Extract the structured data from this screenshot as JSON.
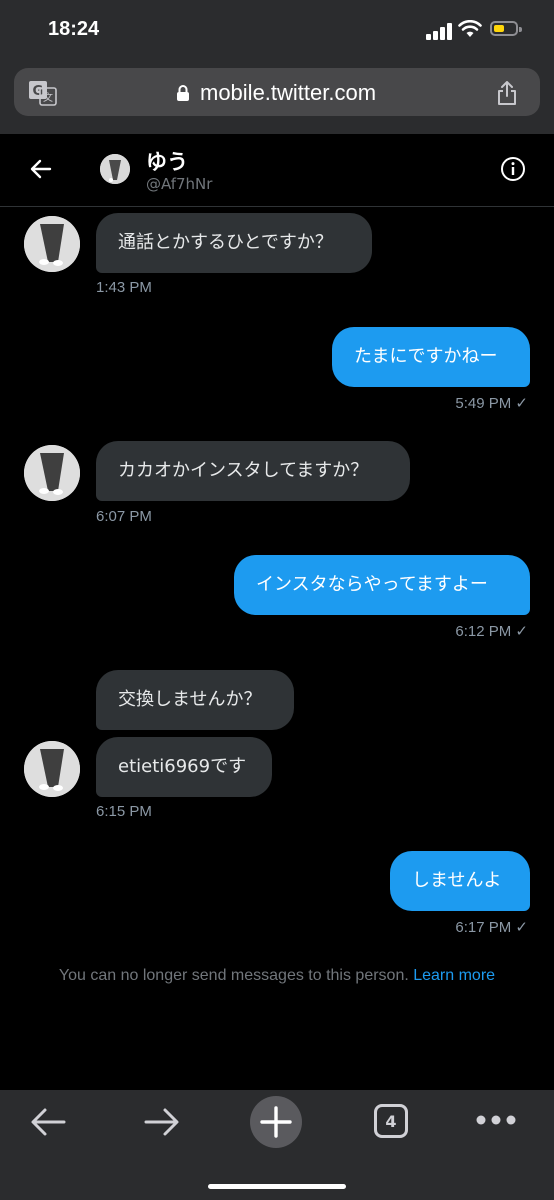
{
  "status_bar": {
    "time": "18:24"
  },
  "browser": {
    "url": "mobile.twitter.com",
    "tab_count": "4"
  },
  "conversation": {
    "name": "ゆう",
    "handle": "@Af7hNr"
  },
  "messages": [
    {
      "direction": "in",
      "text": "通話とかするひとですか？",
      "time": "1:43 PM"
    },
    {
      "direction": "out",
      "text": "たまにですかねー",
      "time": "5:49 PM ✓"
    },
    {
      "direction": "in",
      "text": "カカオかインスタしてますか？",
      "time": "6:07 PM"
    },
    {
      "direction": "out",
      "text": "インスタならやってますよー",
      "time": "6:12 PM ✓"
    },
    {
      "direction": "in",
      "text": "交換しませんか？",
      "time": ""
    },
    {
      "direction": "in",
      "text": "etieti6969です",
      "time": "6:15 PM"
    },
    {
      "direction": "out",
      "text": "しませんよ",
      "time": "6:17 PM ✓"
    }
  ],
  "notice": {
    "text": "You can no longer send messages to this person.",
    "link": "Learn more"
  },
  "colors": {
    "accent": "#1d9bf0",
    "incoming_bubble": "#2f3336",
    "background": "#000000"
  },
  "icons": [
    "translate-icon",
    "lock-icon",
    "share-icon",
    "back-arrow-icon",
    "info-icon",
    "browser-back-icon",
    "browser-forward-icon",
    "new-tab-icon",
    "tabs-icon",
    "more-icon"
  ]
}
